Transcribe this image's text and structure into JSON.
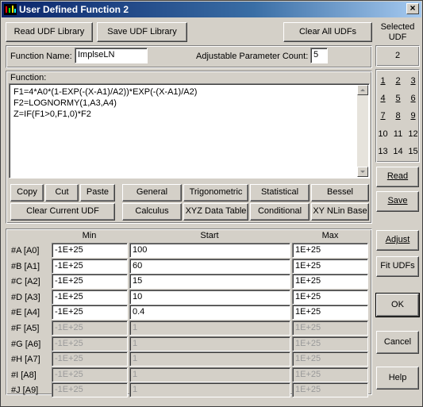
{
  "window": {
    "title": "User Defined Function 2",
    "close": "×"
  },
  "toolbar": {
    "read_lib": "Read UDF Library",
    "save_lib": "Save UDF Library",
    "clear_all": "Clear All UDFs"
  },
  "selected": {
    "label_line1": "Selected",
    "label_line2": "UDF",
    "value": "2"
  },
  "fn_name": {
    "label": "Function Name:",
    "value": "ImplseLN"
  },
  "param_count": {
    "label": "Adjustable Parameter Count:",
    "value": "5"
  },
  "function": {
    "label": "Function:",
    "lines": [
      "F1=4*A0*(1-EXP(-(X-A1)/A2))*EXP(-(X-A1)/A2)",
      "F2=LOGNORMY(1,A3,A4)",
      "Z=IF(F1>0,F1,0)*F2"
    ]
  },
  "edit_buttons": {
    "copy": "Copy",
    "cut": "Cut",
    "paste": "Paste",
    "clear_udf": "Clear Current UDF"
  },
  "categories": {
    "general": "General",
    "trig": "Trigonometric",
    "stat": "Statistical",
    "bessel": "Bessel",
    "calculus": "Calculus",
    "xyz": "XYZ Data Table",
    "conditional": "Conditional",
    "xy": "XY NLin Base"
  },
  "udf_numbers": [
    "1",
    "2",
    "3",
    "4",
    "5",
    "6",
    "7",
    "8",
    "9",
    "10",
    "11",
    "12",
    "13",
    "14",
    "15"
  ],
  "side_buttons": {
    "read": "Read",
    "save": "Save",
    "adjust": "Adjust",
    "fit": "Fit UDFs",
    "ok": "OK",
    "cancel": "Cancel",
    "help": "Help"
  },
  "params": {
    "headers": {
      "min": "Min",
      "start": "Start",
      "max": "Max"
    },
    "rows": [
      {
        "label": "#A [A0]",
        "min": "-1E+25",
        "start": "100",
        "max": "1E+25",
        "enabled": true
      },
      {
        "label": "#B [A1]",
        "min": "-1E+25",
        "start": "60",
        "max": "1E+25",
        "enabled": true
      },
      {
        "label": "#C [A2]",
        "min": "-1E+25",
        "start": "15",
        "max": "1E+25",
        "enabled": true
      },
      {
        "label": "#D [A3]",
        "min": "-1E+25",
        "start": "10",
        "max": "1E+25",
        "enabled": true
      },
      {
        "label": "#E [A4]",
        "min": "-1E+25",
        "start": "0.4",
        "max": "1E+25",
        "enabled": true
      },
      {
        "label": "#F [A5]",
        "min": "-1E+25",
        "start": "1",
        "max": "1E+25",
        "enabled": false
      },
      {
        "label": "#G [A6]",
        "min": "-1E+25",
        "start": "1",
        "max": "1E+25",
        "enabled": false
      },
      {
        "label": "#H [A7]",
        "min": "-1E+25",
        "start": "1",
        "max": "1E+25",
        "enabled": false
      },
      {
        "label": "#I [A8]",
        "min": "-1E+25",
        "start": "1",
        "max": "1E+25",
        "enabled": false
      },
      {
        "label": "#J [A9]",
        "min": "-1E+25",
        "start": "1",
        "max": "1E+25",
        "enabled": false
      }
    ]
  }
}
